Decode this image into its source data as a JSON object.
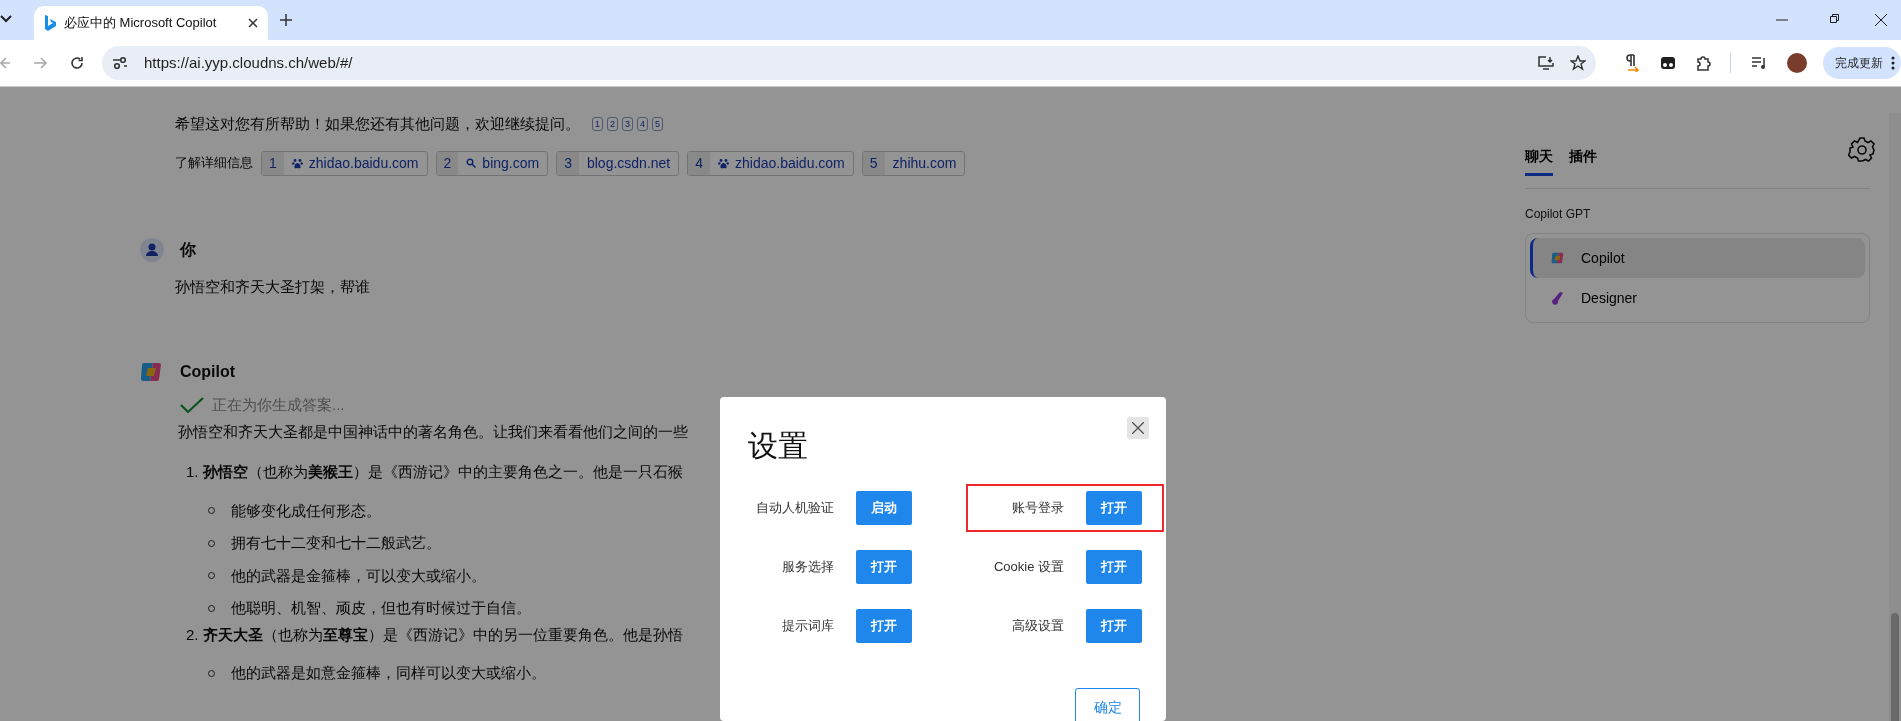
{
  "browser": {
    "tab_title": "必应中的 Microsoft Copilot",
    "url": "https://ai.yyp.cloudns.ch/web/#/",
    "update_button": "完成更新"
  },
  "closing": {
    "text": "希望这对您有所帮助！如果您还有其他问题，欢迎继续提问。",
    "refs": [
      "1",
      "2",
      "3",
      "4",
      "5"
    ]
  },
  "learn_more": {
    "label": "了解详细信息",
    "sources": [
      {
        "num": "1",
        "domain": "zhidao.baidu.com",
        "kind": "baidu"
      },
      {
        "num": "2",
        "domain": "bing.com",
        "kind": "bing"
      },
      {
        "num": "3",
        "domain": "blog.csdn.net",
        "kind": "plain"
      },
      {
        "num": "4",
        "domain": "zhidao.baidu.com",
        "kind": "baidu"
      },
      {
        "num": "5",
        "domain": "zhihu.com",
        "kind": "plain"
      }
    ]
  },
  "user_message": {
    "author": "你",
    "text": "孙悟空和齐天大圣打架，帮谁"
  },
  "copilot_message": {
    "author": "Copilot",
    "status": "正在为你生成答案...",
    "intro": "孙悟空和齐天大圣都是中国神话中的著名角色。让我们来看看他们之间的一些",
    "items": [
      {
        "num": "1.",
        "text": "**孙悟空**（也称为**美猴王**）是《西游记》中的主要角色之一。他是一只石猴",
        "bullets": [
          "能够变化成任何形态。",
          "拥有七十二变和七十二般武艺。",
          "他的武器是金箍棒，可以变大或缩小。",
          "他聪明、机智、顽皮，但也有时候过于自信。"
        ]
      },
      {
        "num": "2.",
        "text": "**齐天大圣**（也称为**至尊宝**）是《西游记》中的另一位重要角色。他是孙悟",
        "bullets": [
          "他的武器是如意金箍棒，同样可以变大或缩小。"
        ]
      }
    ]
  },
  "sidebar": {
    "tabs": [
      {
        "label": "聊天",
        "selected": true
      },
      {
        "label": "插件",
        "selected": false
      }
    ],
    "section": "Copilot GPT",
    "items": [
      {
        "label": "Copilot",
        "selected": true,
        "kind": "copilot"
      },
      {
        "label": "Designer",
        "selected": false,
        "kind": "designer"
      }
    ]
  },
  "dialog": {
    "title": "设置",
    "settings": [
      {
        "label": "自动人机验证",
        "button": "启动",
        "highlighted": false
      },
      {
        "label": "账号登录",
        "button": "打开",
        "highlighted": true
      },
      {
        "label": "服务选择",
        "button": "打开",
        "highlighted": false
      },
      {
        "label": "Cookie 设置",
        "button": "打开",
        "highlighted": false
      },
      {
        "label": "提示词库",
        "button": "打开",
        "highlighted": false
      },
      {
        "label": "高级设置",
        "button": "打开",
        "highlighted": false
      }
    ],
    "confirm": "确定"
  }
}
